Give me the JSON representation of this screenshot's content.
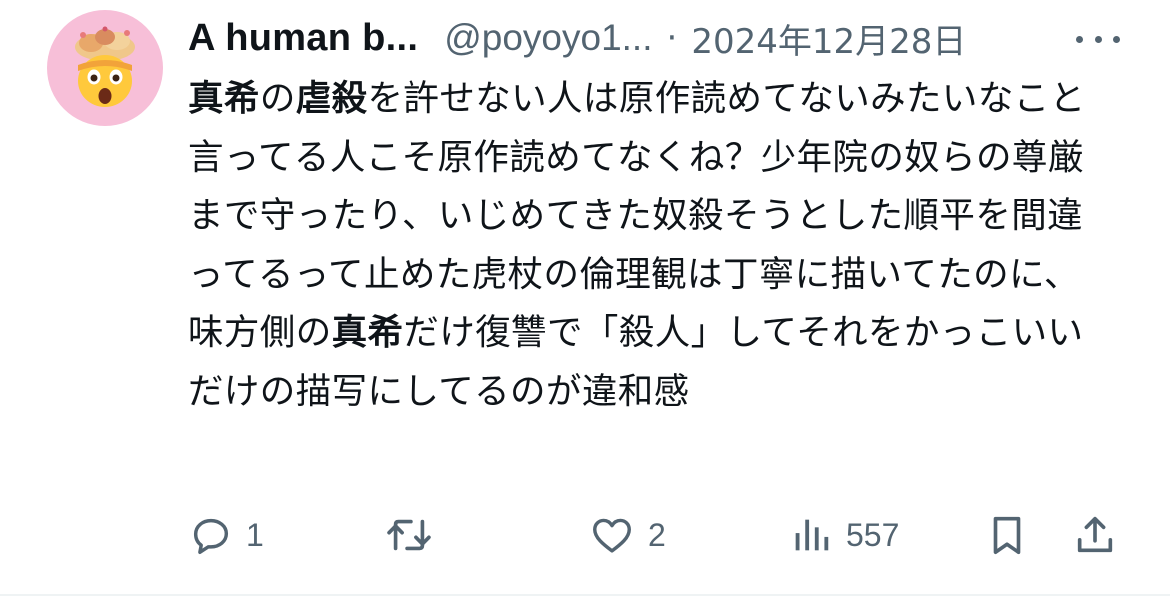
{
  "author": {
    "display_name": "A human b...",
    "handle": "@poyoyo1...",
    "separator": "·",
    "date": "2024年12月28日",
    "avatar_icon": "exploding-head-emoji-icon",
    "avatar_bg": "#f7bfd8"
  },
  "tweet": {
    "segments": [
      {
        "text": "真希",
        "bold": true
      },
      {
        "text": "の",
        "bold": false
      },
      {
        "text": "虐殺",
        "bold": true
      },
      {
        "text": "を許せない人は原作読めてないみたいなこと言ってる人こそ原作読めてなくね？少年院の奴らの尊厳まで守ったり、いじめてきた奴殺そうとした順平を間違ってるって止めた虎杖の倫理観は丁寧に描いてたのに、味方側の",
        "bold": false
      },
      {
        "text": "真希",
        "bold": true
      },
      {
        "text": "だけ復讐で「殺人」してそれをかっこいいだけの描写にしてるのが違和感",
        "bold": false
      }
    ]
  },
  "actions": {
    "reply": {
      "icon": "reply-icon",
      "count": "1"
    },
    "repost": {
      "icon": "repost-icon",
      "count": ""
    },
    "like": {
      "icon": "heart-icon",
      "count": "2"
    },
    "views": {
      "icon": "views-chart-icon",
      "count": "557"
    },
    "bookmark": {
      "icon": "bookmark-icon"
    },
    "share": {
      "icon": "share-icon"
    }
  },
  "colors": {
    "text_primary": "#0f1419",
    "text_secondary": "#536471",
    "divider": "#eff3f4"
  }
}
